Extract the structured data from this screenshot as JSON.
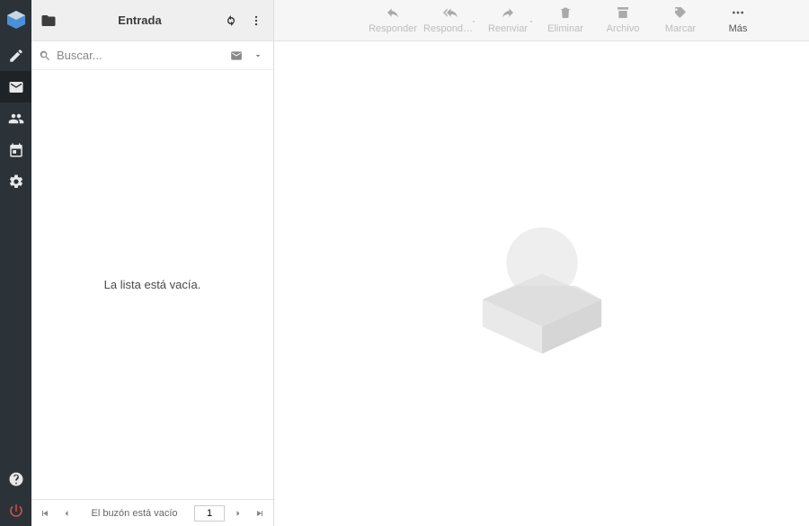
{
  "header": {
    "title": "Entrada"
  },
  "search": {
    "placeholder": "Buscar..."
  },
  "list": {
    "empty_text": "La lista está vacía."
  },
  "footer": {
    "status": "El buzón está vacío",
    "page": "1"
  },
  "toolbar": {
    "reply": "Responder",
    "reply_all": "Responder …",
    "forward": "Reenviar",
    "delete": "Eliminar",
    "archive": "Archivo",
    "mark": "Marcar",
    "more": "Más"
  }
}
